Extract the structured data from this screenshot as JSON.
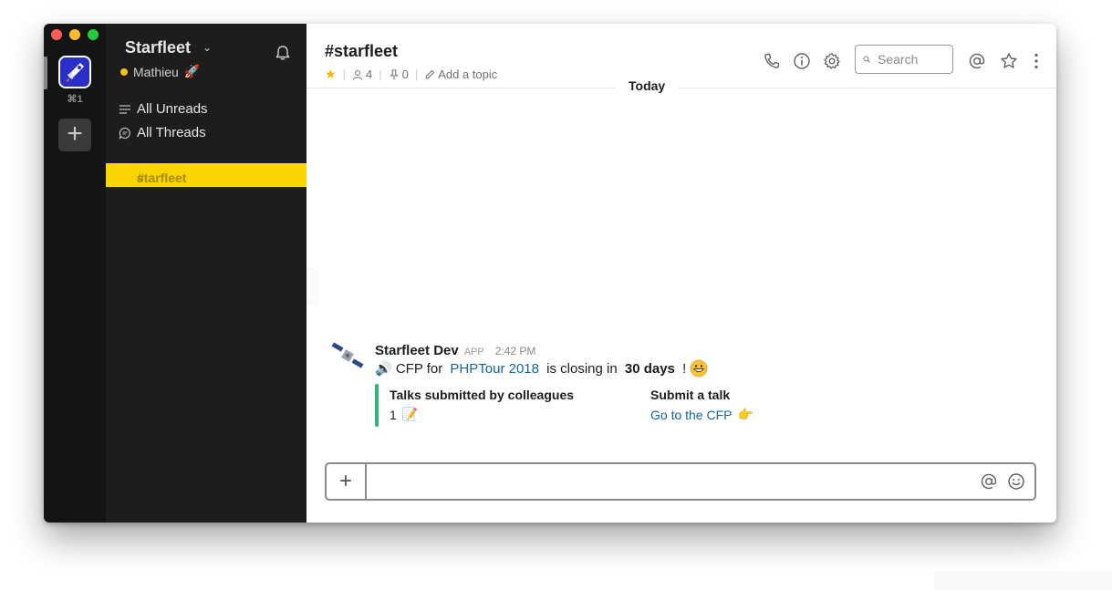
{
  "window": {
    "traffic_lights": [
      "#fc5f57",
      "#fdbc2e",
      "#28c840"
    ]
  },
  "rail": {
    "team_shortcut": "⌘1",
    "add_team_label": "+"
  },
  "sidebar": {
    "team_name": "Starfleet",
    "user_name": "Mathieu",
    "user_emoji": "🚀",
    "nav": [
      {
        "label": "All Unreads",
        "icon": "lines-icon"
      },
      {
        "label": "All Threads",
        "icon": "thread-icon"
      }
    ],
    "channels": [
      {
        "label": "starfleet",
        "prefix": "#",
        "selected": true
      }
    ],
    "colors": {
      "selected_bg": "#fad500",
      "selected_text": "#a48b00",
      "bg": "#1d1d1d"
    }
  },
  "header": {
    "channel_title": "#starfleet",
    "member_count": "4",
    "pin_count": "0",
    "add_topic": "Add a topic",
    "search_placeholder": "Search"
  },
  "messages": {
    "day_divider": "Today",
    "items": [
      {
        "sender": "Starfleet Dev",
        "badge": "APP",
        "time": "2:42 PM",
        "text_prefix": "🔊 CFP for ",
        "link_text": "PHPTour 2018",
        "text_mid": " is closing in ",
        "bold_text": "30 days",
        "text_suffix": " !",
        "attachment": {
          "color": "#2eb67d",
          "fields": [
            {
              "title": "Talks submitted by colleagues",
              "value": "1",
              "emoji": "📝"
            },
            {
              "title": "Submit a talk",
              "link": "Go to the CFP",
              "emoji": "👉"
            }
          ]
        }
      }
    ]
  },
  "composer": {
    "plus_label": "+",
    "value": ""
  }
}
